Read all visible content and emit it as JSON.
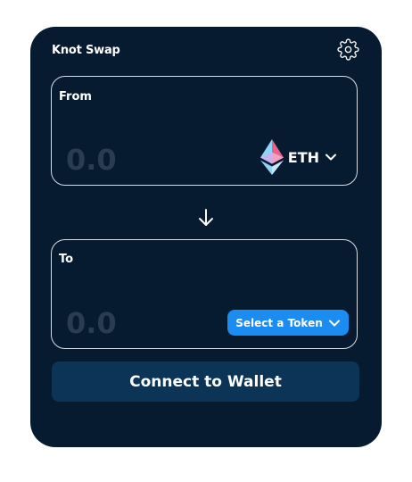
{
  "app": {
    "title": "Knot Swap"
  },
  "from": {
    "label": "From",
    "amount_placeholder": "0.0",
    "token_symbol": "ETH"
  },
  "to": {
    "label": "To",
    "amount_placeholder": "0.0",
    "select_token_label": "Select a Token"
  },
  "actions": {
    "connect_wallet_label": "Connect to Wallet"
  },
  "icons": {
    "settings": "gear-icon",
    "swap": "arrow-down-icon",
    "token_logo": "ethereum-logo-icon",
    "dropdown": "chevron-down-icon"
  },
  "colors": {
    "card_background": "#061a30",
    "panel_border": "#d8dde4",
    "primary_button": "#1a8cf2",
    "connect_button": "#0b3456",
    "placeholder_text": "#2a3c52",
    "text": "#ffffff"
  }
}
